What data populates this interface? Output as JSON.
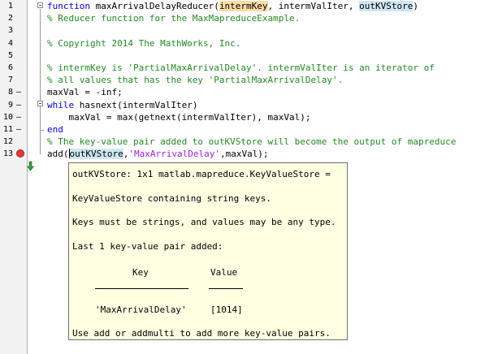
{
  "editor": {
    "lines": [
      {
        "n": "1",
        "mark": "",
        "segments": [
          {
            "t": "function",
            "c": "kw"
          },
          {
            "t": " maxArrivalDelayReducer(",
            "c": ""
          },
          {
            "t": "intermKey",
            "c": "hl-orange"
          },
          {
            "t": ", intermValIter, ",
            "c": ""
          },
          {
            "t": "outKVStore",
            "c": "hl-blue"
          },
          {
            "t": ")",
            "c": ""
          }
        ]
      },
      {
        "n": "2",
        "mark": "",
        "segments": [
          {
            "t": "% Reducer function for the MaxMapreduceExample.",
            "c": "cm"
          }
        ]
      },
      {
        "n": "3",
        "mark": "",
        "segments": []
      },
      {
        "n": "4",
        "mark": "",
        "segments": [
          {
            "t": "% Copyright 2014 The MathWorks, Inc.",
            "c": "cm"
          }
        ]
      },
      {
        "n": "5",
        "mark": "",
        "segments": []
      },
      {
        "n": "6",
        "mark": "",
        "segments": [
          {
            "t": "% intermKey is 'PartialMaxArrivalDelay'. intermValIter is an iterator of",
            "c": "cm"
          }
        ]
      },
      {
        "n": "7",
        "mark": "",
        "segments": [
          {
            "t": "% all values that has the key 'PartialMaxArrivalDelay'.",
            "c": "cm"
          }
        ]
      },
      {
        "n": "8",
        "mark": "–",
        "segments": [
          {
            "t": "maxVal = -inf;",
            "c": ""
          }
        ]
      },
      {
        "n": "9",
        "mark": "–",
        "segments": [
          {
            "t": "while",
            "c": "kw"
          },
          {
            "t": " hasnext(intermValIter)",
            "c": ""
          }
        ]
      },
      {
        "n": "10",
        "mark": "–",
        "segments": [
          {
            "t": "    maxVal = max(getnext(intermValIter), maxVal);",
            "c": ""
          }
        ]
      },
      {
        "n": "11",
        "mark": "–",
        "segments": [
          {
            "t": "end",
            "c": "kw"
          }
        ]
      },
      {
        "n": "12",
        "mark": "",
        "segments": [
          {
            "t": "% The key-value pair added to outKVStore will become the output of mapreduce",
            "c": "cm"
          }
        ]
      },
      {
        "n": "13",
        "mark": "bp",
        "segments": [
          {
            "t": "add(",
            "c": ""
          },
          {
            "t": "|",
            "c": "cursor"
          },
          {
            "t": "outKVStore",
            "c": "hl-blue"
          },
          {
            "t": ",",
            "c": ""
          },
          {
            "t": "'MaxArrivalDelay'",
            "c": "str"
          },
          {
            "t": ",maxVal);",
            "c": ""
          }
        ]
      }
    ]
  },
  "tooltip": {
    "header": "outKVStore: 1x1 matlab.mapreduce.KeyValueStore =",
    "line1": "KeyValueStore containing string keys.",
    "line2": "Keys must be strings, and values may be any type.",
    "line3": "Last 1 key-value pair added:",
    "col_key": "Key",
    "col_value": "Value",
    "row_key": "'MaxArrivalDelay'",
    "row_value": "[1014]",
    "footer": "Use add or addmulti to add more key-value pairs."
  }
}
